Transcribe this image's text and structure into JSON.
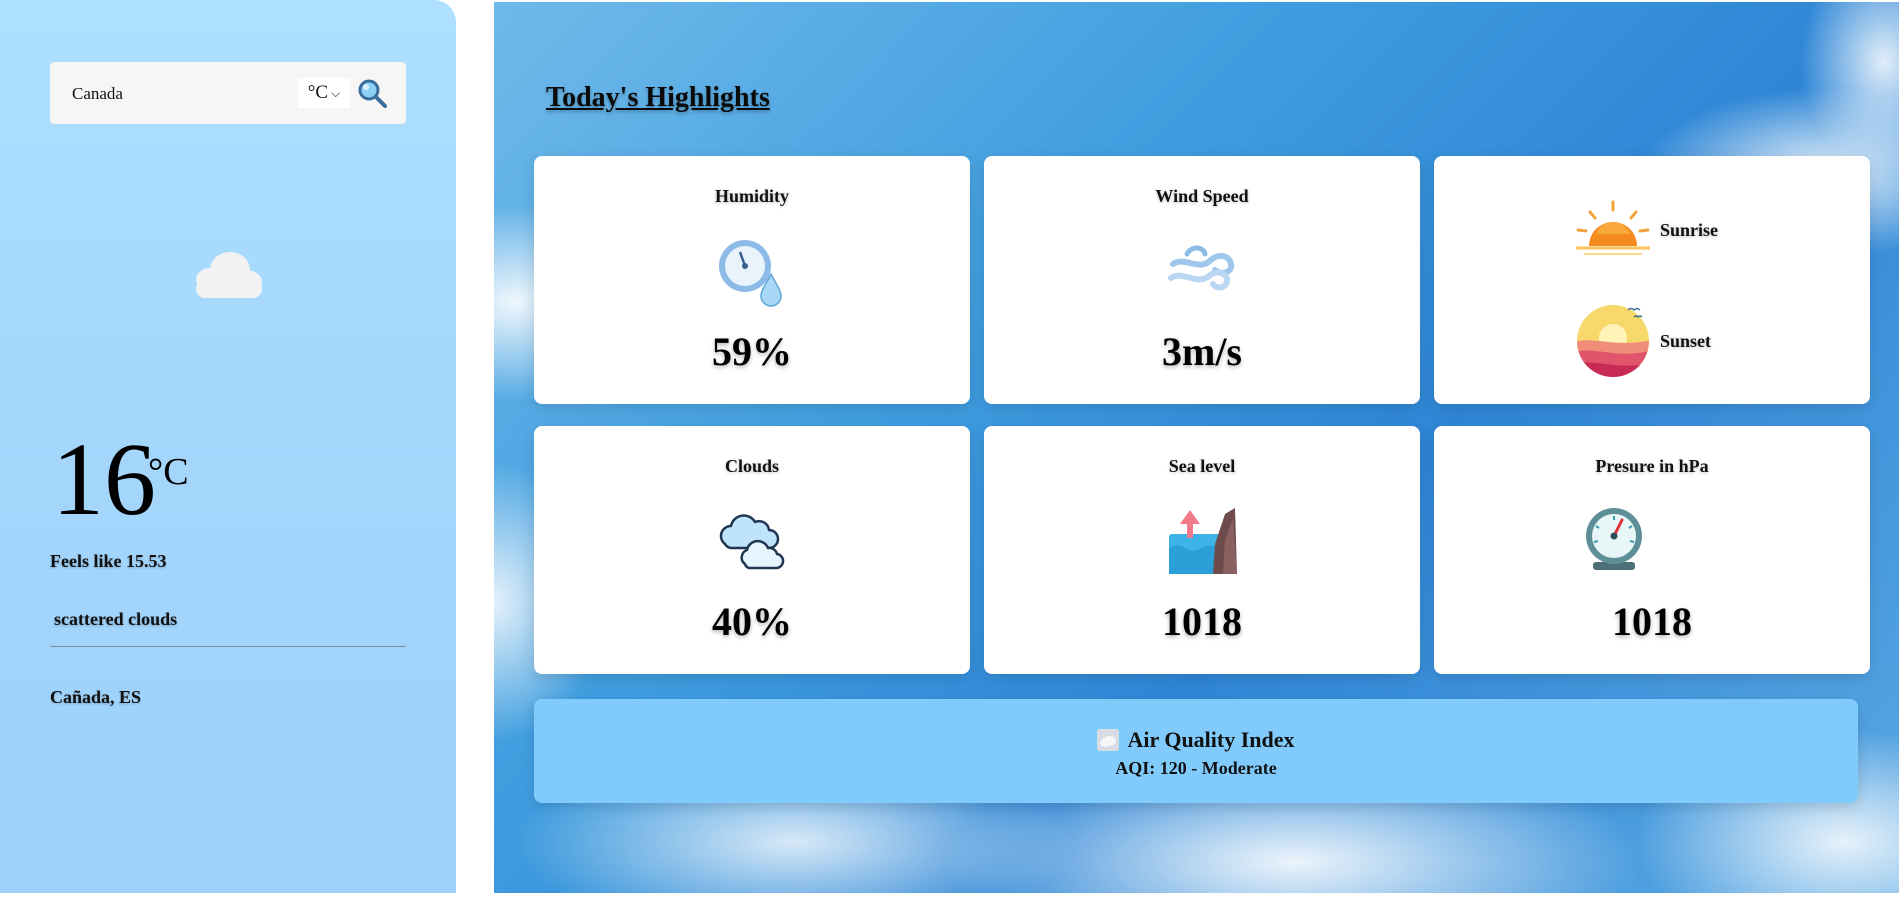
{
  "search": {
    "value": "Canada",
    "placeholder": ""
  },
  "unit_select": {
    "selected": "°C",
    "icon": "chevron-down-icon"
  },
  "search_button": {
    "icon": "magnifier-icon"
  },
  "current": {
    "icon": "cloud-icon",
    "temperature": "16",
    "unit": "°C",
    "feels_like": "Feels like 15.53",
    "description": "scattered clouds",
    "location": "Cañada, ES"
  },
  "highlights": {
    "heading": "Today's Highlights",
    "humidity": {
      "title": "Humidity",
      "value": "59%",
      "icon": "humidity-gauge-icon"
    },
    "wind": {
      "title": "Wind Speed",
      "value": "3m/s",
      "icon": "wind-icon"
    },
    "sunrise": {
      "label": "Sunrise",
      "icon": "sunrise-icon"
    },
    "sunset": {
      "label": "Sunset",
      "icon": "sunset-icon"
    },
    "clouds": {
      "title": "Clouds",
      "value": "40%",
      "icon": "clouds-icon"
    },
    "sea_level": {
      "title": "Sea level",
      "value": "1018",
      "icon": "sea-level-icon"
    },
    "pressure": {
      "title": "Presure in hPa",
      "value": "1018",
      "icon": "barometer-icon"
    }
  },
  "aqi": {
    "title": "Air Quality Index",
    "value": "AQI: 120 - Moderate",
    "icon": "cloud-emoji-icon"
  },
  "colors": {
    "sidebar": "#a6d8fd",
    "search_box": "#f6f6f6",
    "aqi_panel": "#81cbfc",
    "card": "#ffffff",
    "sky": "#3f9ddf"
  }
}
